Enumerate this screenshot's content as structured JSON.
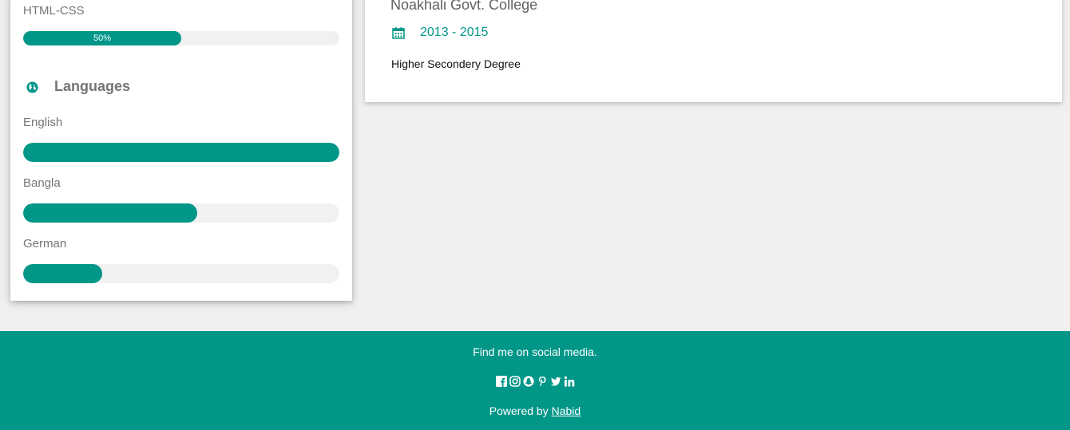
{
  "skills": {
    "html_css": {
      "label": "HTML-CSS",
      "percent_label": "50%",
      "level": 0.5
    }
  },
  "languages": {
    "title": "Languages",
    "items": [
      {
        "label": "English",
        "level": 1.0
      },
      {
        "label": "Bangla",
        "level": 0.55
      },
      {
        "label": "German",
        "level": 0.25
      }
    ]
  },
  "education": {
    "institution": "Noakhali Govt. College",
    "dates": "2013 - 2015",
    "degree": "Higher Secondery Degree"
  },
  "footer": {
    "tagline": "Find me on social media.",
    "social_icons": [
      "facebook-icon",
      "instagram-icon",
      "snapchat-icon",
      "pinterest-icon",
      "twitter-icon",
      "linkedin-icon"
    ],
    "powered_prefix": "Powered by ",
    "powered_link": "Nabid"
  },
  "colors": {
    "accent": "#009688",
    "background": "#f0f0f0",
    "card": "#ffffff",
    "track": "#f1f1f1"
  }
}
